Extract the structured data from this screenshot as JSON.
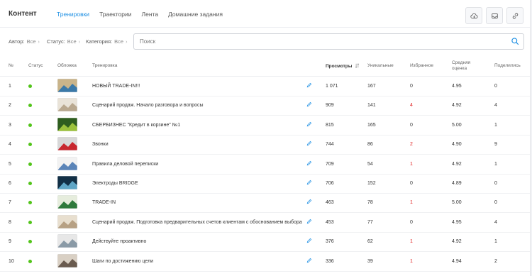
{
  "header": {
    "title": "Контент",
    "tabs": [
      {
        "label": "Тренировки",
        "active": true
      },
      {
        "label": "Траектории",
        "active": false
      },
      {
        "label": "Лента",
        "active": false
      },
      {
        "label": "Домашние задания",
        "active": false
      }
    ],
    "toolbar_icons": [
      "cloud-download-icon",
      "inbox-icon",
      "link-icon"
    ]
  },
  "filters": {
    "author_label": "Автор:",
    "author_value": "Все",
    "status_label": "Статус:",
    "status_value": "Все",
    "category_label": "Категория:",
    "category_value": "Все",
    "search_placeholder": "Поиск"
  },
  "table": {
    "columns": {
      "num": "№",
      "status": "Статус",
      "cover": "Обложка",
      "training": "Тренировка",
      "views": "Просмотры",
      "unique": "Уникальные",
      "favorite": "Избранное",
      "rating_1": "Средняя",
      "rating_2": "оценка",
      "shared": "Поделились"
    },
    "status_color": "#52c41a",
    "highlight_color": "#e02020",
    "rows": [
      {
        "num": "1",
        "title": "НОВЫЙ TRADE-IN!!!",
        "views": "1 071",
        "unique": "167",
        "favorite": "0",
        "rating": "4.95",
        "shared": "0",
        "thumb_colors": [
          "#c9b48a",
          "#3b79a8"
        ]
      },
      {
        "num": "2",
        "title": "Сценарий продаж. Начало разговора и вопросы",
        "views": "909",
        "unique": "141",
        "favorite": "4",
        "rating": "4.92",
        "shared": "4",
        "thumb_colors": [
          "#e9e3d8",
          "#b9a88f"
        ]
      },
      {
        "num": "3",
        "title": "СБЕРБИЗНЕС \"Кредит в корзине\" №1",
        "views": "815",
        "unique": "165",
        "favorite": "0",
        "rating": "5.00",
        "shared": "1",
        "thumb_colors": [
          "#2f5e1f",
          "#9cc23c"
        ]
      },
      {
        "num": "4",
        "title": "Звонки",
        "views": "744",
        "unique": "86",
        "favorite": "2",
        "rating": "4.90",
        "shared": "9",
        "thumb_colors": [
          "#d8d8d8",
          "#c8272f"
        ]
      },
      {
        "num": "5",
        "title": "Правила деловой переписки",
        "views": "709",
        "unique": "54",
        "favorite": "1",
        "rating": "4.92",
        "shared": "1",
        "thumb_colors": [
          "#f2f2f2",
          "#5a84b8"
        ]
      },
      {
        "num": "6",
        "title": "Электроды BRIDGE",
        "views": "706",
        "unique": "152",
        "favorite": "0",
        "rating": "4.89",
        "shared": "0",
        "thumb_colors": [
          "#123046",
          "#5fa6c6"
        ]
      },
      {
        "num": "7",
        "title": "TRADE-IN",
        "views": "463",
        "unique": "78",
        "favorite": "1",
        "rating": "5.00",
        "shared": "0",
        "thumb_colors": [
          "#e6eddd",
          "#2f7a3c"
        ]
      },
      {
        "num": "8",
        "title": "Сценарий продаж. Подготовка предварительных счетов клиентам с обоснованием выбора",
        "views": "453",
        "unique": "77",
        "favorite": "0",
        "rating": "4.95",
        "shared": "4",
        "thumb_colors": [
          "#e8dfcf",
          "#b7a184"
        ]
      },
      {
        "num": "9",
        "title": "Действуйте проактивно",
        "views": "376",
        "unique": "62",
        "favorite": "1",
        "rating": "4.92",
        "shared": "1",
        "thumb_colors": [
          "#e7e7e7",
          "#8a9aa6"
        ]
      },
      {
        "num": "10",
        "title": "Шаги по достижению цели",
        "views": "336",
        "unique": "39",
        "favorite": "1",
        "rating": "4.94",
        "shared": "2",
        "thumb_colors": [
          "#d9d0c4",
          "#6a5b4f"
        ]
      }
    ]
  }
}
